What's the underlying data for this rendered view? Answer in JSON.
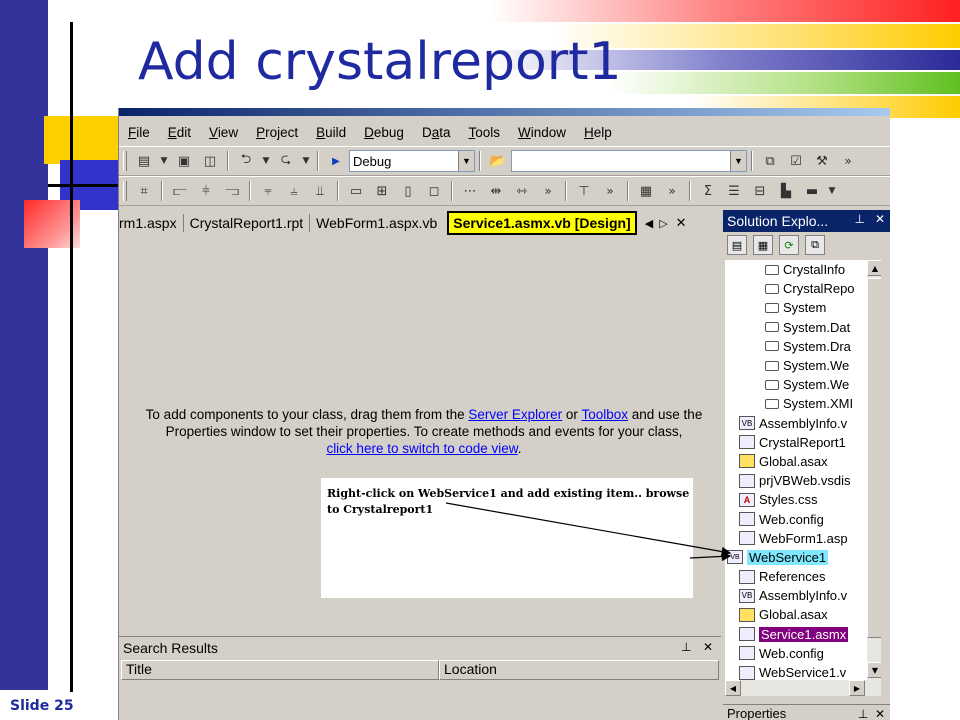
{
  "slide": {
    "title": "Add crystalreport1",
    "number": "Slide 25"
  },
  "menu": [
    {
      "label": "File",
      "key": "F"
    },
    {
      "label": "Edit",
      "key": "E"
    },
    {
      "label": "View",
      "key": "V"
    },
    {
      "label": "Project",
      "key": "P"
    },
    {
      "label": "Build",
      "key": "B"
    },
    {
      "label": "Debug",
      "key": "D"
    },
    {
      "label": "Data",
      "key": "a"
    },
    {
      "label": "Tools",
      "key": "T"
    },
    {
      "label": "Window",
      "key": "W"
    },
    {
      "label": "Help",
      "key": "H"
    }
  ],
  "toolbar": {
    "config_value": "Debug",
    "find_value": ""
  },
  "tabs": {
    "items": [
      "rm1.aspx",
      "CrystalReport1.rpt",
      "WebForm1.aspx.vb"
    ],
    "active": "Service1.asmx.vb [Design]"
  },
  "designer": {
    "msg_part1": "To add components to your class, drag them from the",
    "server_explorer": "Server Explorer",
    "msg_or": "or",
    "toolbox": "Toolbox",
    "msg_part2": "and use the Properties window to set their properties. To create methods and events for your class,",
    "code_link": "click here to switch to code view",
    "period": "."
  },
  "note": {
    "text": "Right-click on WebService1 and add existing item.. browse to Crystalreport1"
  },
  "search_results": {
    "title": "Search Results",
    "columns": [
      "Title",
      "Location"
    ]
  },
  "solution_explorer": {
    "title": "Solution Explo...",
    "references": [
      "CrystalInfo",
      "CrystalRepo",
      "System",
      "System.Dat",
      "System.Dra",
      "System.We",
      "System.We",
      "System.XMI"
    ],
    "files": [
      "AssemblyInfo.v",
      "CrystalReport1",
      "Global.asax",
      "prjVBWeb.vsdis",
      "Styles.css",
      "Web.config",
      "WebForm1.asp"
    ],
    "project": "WebService1",
    "project_items": [
      "References",
      "AssemblyInfo.v",
      "Global.asax",
      "Service1.asmx",
      "Web.config",
      "WebService1.v"
    ]
  },
  "properties": {
    "title": "Properties"
  }
}
